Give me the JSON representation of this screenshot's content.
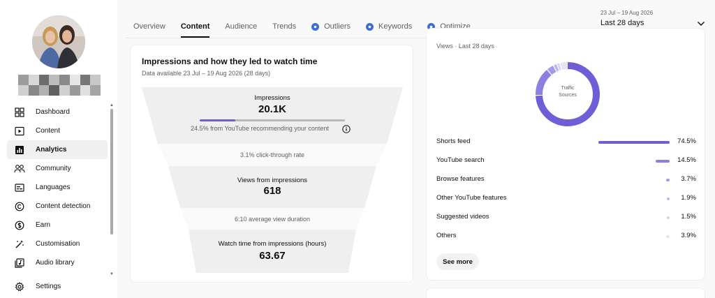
{
  "sidebar": {
    "items": [
      {
        "label": "Dashboard",
        "icon": "dashboard-icon"
      },
      {
        "label": "Content",
        "icon": "content-icon"
      },
      {
        "label": "Analytics",
        "icon": "analytics-icon",
        "active": true
      },
      {
        "label": "Community",
        "icon": "community-icon"
      },
      {
        "label": "Languages",
        "icon": "languages-icon"
      },
      {
        "label": "Content detection",
        "icon": "copyright-icon"
      },
      {
        "label": "Earn",
        "icon": "dollar-icon"
      },
      {
        "label": "Customisation",
        "icon": "magic-wand-icon"
      },
      {
        "label": "Audio library",
        "icon": "audio-library-icon"
      }
    ],
    "settings_label": "Settings"
  },
  "tabs": [
    {
      "label": "Overview"
    },
    {
      "label": "Content",
      "active": true
    },
    {
      "label": "Audience"
    },
    {
      "label": "Trends"
    },
    {
      "label": "Outliers",
      "badge": true
    },
    {
      "label": "Keywords",
      "badge": true
    },
    {
      "label": "Optimize",
      "badge": true
    }
  ],
  "date": {
    "range": "23 Jul – 19 Aug 2026",
    "label": "Last 28 days"
  },
  "funnel_card": {
    "title": "Impressions and how they led to watch time",
    "subtitle": "Data available 23 Jul – 19 Aug 2026 (28 days)",
    "impressions_label": "Impressions",
    "impressions_value": "20.1K",
    "recommend_note": "24.5% from YouTube recommending your content",
    "recommend_fraction": 0.245,
    "ctr_note": "3.1% click-through rate",
    "views_label": "Views from impressions",
    "views_value": "618",
    "avd_note": "6:10 average view duration",
    "watch_label": "Watch time from impressions (hours)",
    "watch_value": "63.67"
  },
  "traffic_card": {
    "subtitle": "Views · Last 28 days",
    "donut_label_line1": "Traffic",
    "donut_label_line2": "Sources",
    "see_more_label": "See more",
    "accent": "#6e5fd6"
  },
  "chart_data": {
    "type": "pie",
    "title": "",
    "categories": [
      "Shorts feed",
      "YouTube search",
      "Browse features",
      "Other YouTube features",
      "Suggested videos",
      "Others"
    ],
    "values": [
      74.5,
      14.5,
      3.7,
      1.9,
      1.5,
      3.9
    ],
    "labels": [
      "74.5%",
      "14.5%",
      "3.7%",
      "1.9%",
      "1.5%",
      "3.9%"
    ],
    "colors": [
      "#6e5fd6",
      "#8b80e0",
      "#a49be6",
      "#bdb6ec",
      "#d6d2f2",
      "#e6e4f3"
    ],
    "legend": "right-list"
  }
}
